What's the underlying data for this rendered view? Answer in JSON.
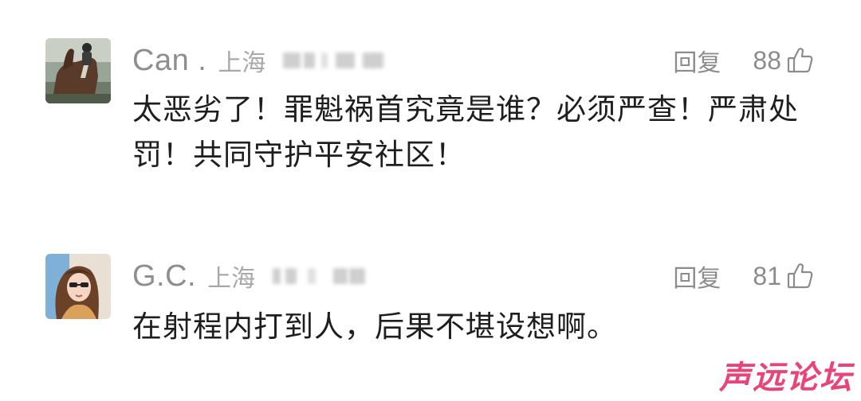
{
  "comments": [
    {
      "username": "Can .",
      "location": "上海",
      "reply_label": "回复",
      "like_count": "88",
      "text": "太恶劣了！罪魁祸首究竟是谁？必须严查！严肃处罚！共同守护平安社区！"
    },
    {
      "username": "G.C.",
      "location": "上海",
      "reply_label": "回复",
      "like_count": "81",
      "text": "在射程内打到人，后果不堪设想啊。"
    }
  ],
  "watermark": "声远论坛",
  "colors": {
    "username": "#8e8e8e",
    "meta": "#a8a8a8",
    "body_text": "#1e1e1e",
    "watermark": "#e8356d"
  }
}
